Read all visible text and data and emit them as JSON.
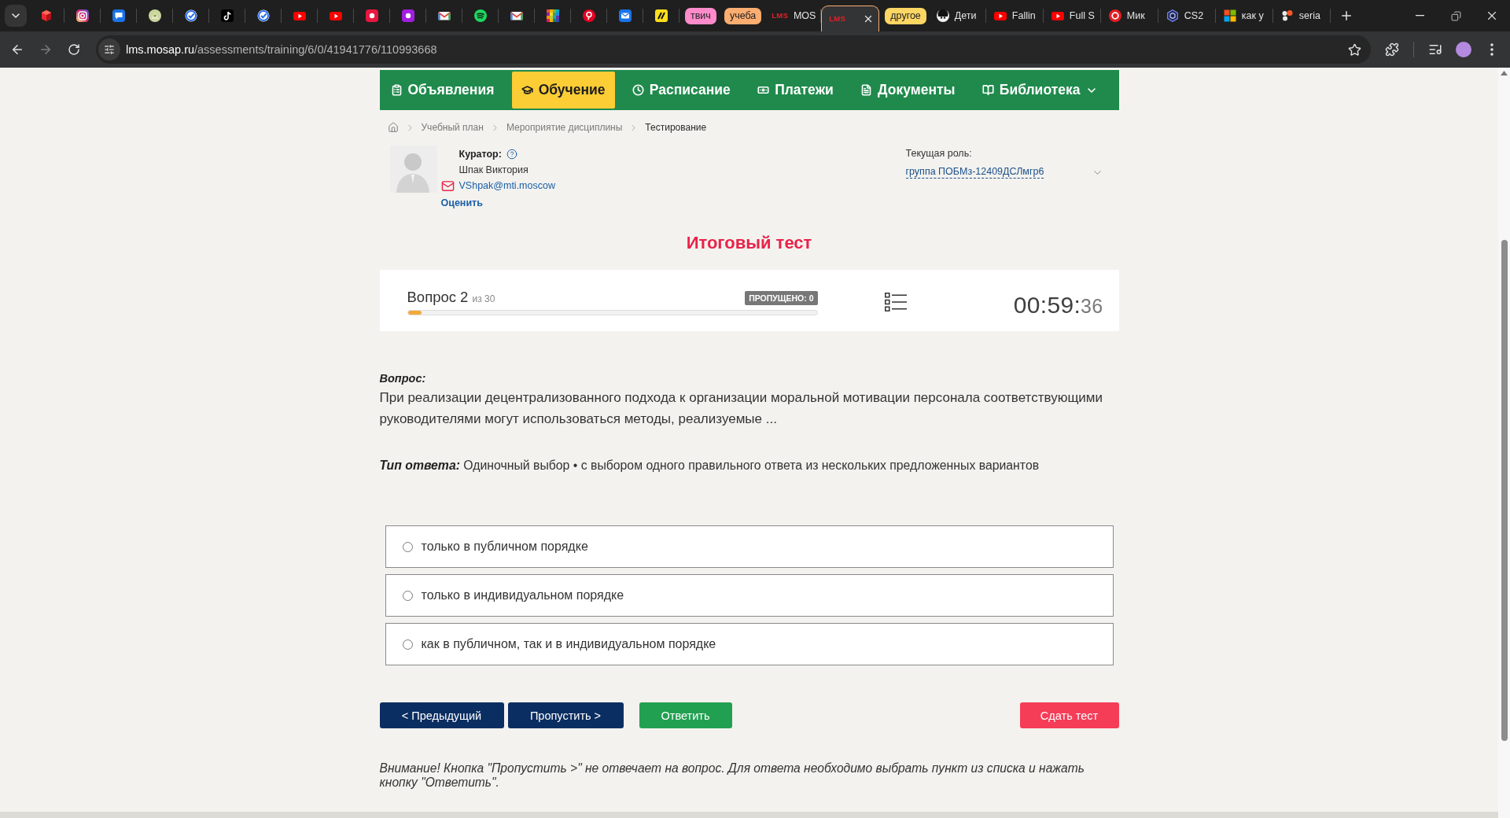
{
  "browser": {
    "tabs": [
      {
        "kind": "group",
        "label": "твич",
        "color": "#ff8bcb"
      },
      {
        "kind": "group",
        "label": "учеба",
        "color": "#fcad70"
      },
      {
        "kind": "tab",
        "logo": "LMS",
        "title": "MOS",
        "selected": false
      },
      {
        "kind": "tab",
        "logo": "LMS",
        "selected": true
      },
      {
        "kind": "group",
        "label": "другое",
        "color": "#fdd663"
      },
      {
        "kind": "tab",
        "title": "Дети",
        "selected": false
      },
      {
        "kind": "tab",
        "title": "Fallin",
        "selected": false
      },
      {
        "kind": "tab",
        "title": "Full S",
        "selected": false
      },
      {
        "kind": "tab",
        "title": "Мик",
        "selected": false
      },
      {
        "kind": "tab",
        "title": "CS2",
        "selected": false
      },
      {
        "kind": "tab",
        "title": "как у",
        "selected": false
      },
      {
        "kind": "tab",
        "title": "seria",
        "selected": false
      }
    ],
    "address": {
      "host": "lms.mosap.ru",
      "path": "/assessments/training/6/0/41941776/110993668"
    }
  },
  "nav": {
    "items": [
      {
        "kind": "announcements",
        "label": "Объявления",
        "selected": false,
        "menu": false
      },
      {
        "kind": "study",
        "label": "Обучение",
        "selected": true,
        "menu": false
      },
      {
        "kind": "schedule",
        "label": "Расписание",
        "selected": false,
        "menu": false
      },
      {
        "kind": "payments",
        "label": "Платежи",
        "selected": false,
        "menu": false
      },
      {
        "kind": "documents",
        "label": "Документы",
        "selected": false,
        "menu": false
      },
      {
        "kind": "library",
        "label": "Библиотека",
        "selected": false,
        "menu": true
      }
    ]
  },
  "breadcrumb": [
    {
      "label": "Учебный план",
      "current": false
    },
    {
      "label": "Мероприятие дисциплины",
      "current": false
    },
    {
      "label": "Тестирование",
      "current": true
    }
  ],
  "curator": {
    "label": "Куратор:",
    "name": "Шпак Виктория",
    "email": "VShpak@mti.moscow",
    "rate_link": "Оценить"
  },
  "role": {
    "label": "Текущая роль:",
    "value": "группа ПОБМз-12409ДСЛмгр6"
  },
  "title": "Итоговый тест",
  "header": {
    "question_label": "Вопрос 2",
    "question_total": "из 30",
    "skipped_badge": "ПРОПУЩЕНО: 0",
    "progress": {
      "level": 0.033
    },
    "timer": {
      "main": "00:59:",
      "seconds": "36"
    }
  },
  "question": {
    "label": "Вопрос:",
    "text": "При реализации децентрализованного подхода к организации моральной мотивации персонала соответствующими руководителями могут использоваться методы, реализуемые ..."
  },
  "answer_type": {
    "label": "Тип ответа:",
    "value": "Одиночный выбор • с выбором одного правильного ответа из нескольких предложенных вариантов"
  },
  "options": [
    {
      "text": "только в публичном порядке",
      "selected": false
    },
    {
      "text": "только в индивидуальном порядке",
      "selected": false
    },
    {
      "text": "как в публичном, так и в индивидуальном порядке",
      "selected": false
    }
  ],
  "buttons": [
    {
      "kind": "previous",
      "label": "< Предыдущий"
    },
    {
      "kind": "skip",
      "label": "Пропустить >"
    },
    {
      "kind": "answer",
      "label": "Ответить"
    },
    {
      "kind": "submit",
      "label": "Сдать тест"
    }
  ],
  "note": "Внимание! Кнопка \"Пропустить >\" не отвечает на вопрос. Для ответа необходимо выбрать пункт из списка и нажать кнопку \"Ответить\"."
}
